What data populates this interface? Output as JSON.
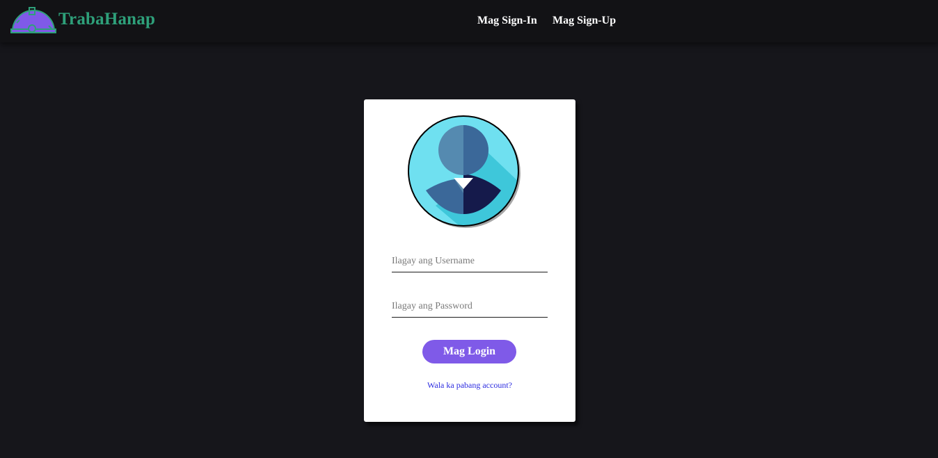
{
  "header": {
    "brand": "TrabaHanap",
    "nav": [
      {
        "label": "Mag Sign-In"
      },
      {
        "label": "Mag Sign-Up"
      }
    ]
  },
  "login": {
    "username_placeholder": "Ilagay ang Username",
    "password_placeholder": "Ilagay ang Password",
    "submit_label": "Mag Login",
    "signup_prompt": "Wala ka pabang account?"
  },
  "icons": {
    "logo": "hardhat-logo-icon",
    "avatar": "user-avatar-icon"
  },
  "colors": {
    "page_bg": "#16161b",
    "navbar_bg": "#121215",
    "brand": "#2ea07a",
    "logo": "#7f5ae8",
    "button": "#7f5ae8",
    "link": "#2a2ae0"
  }
}
